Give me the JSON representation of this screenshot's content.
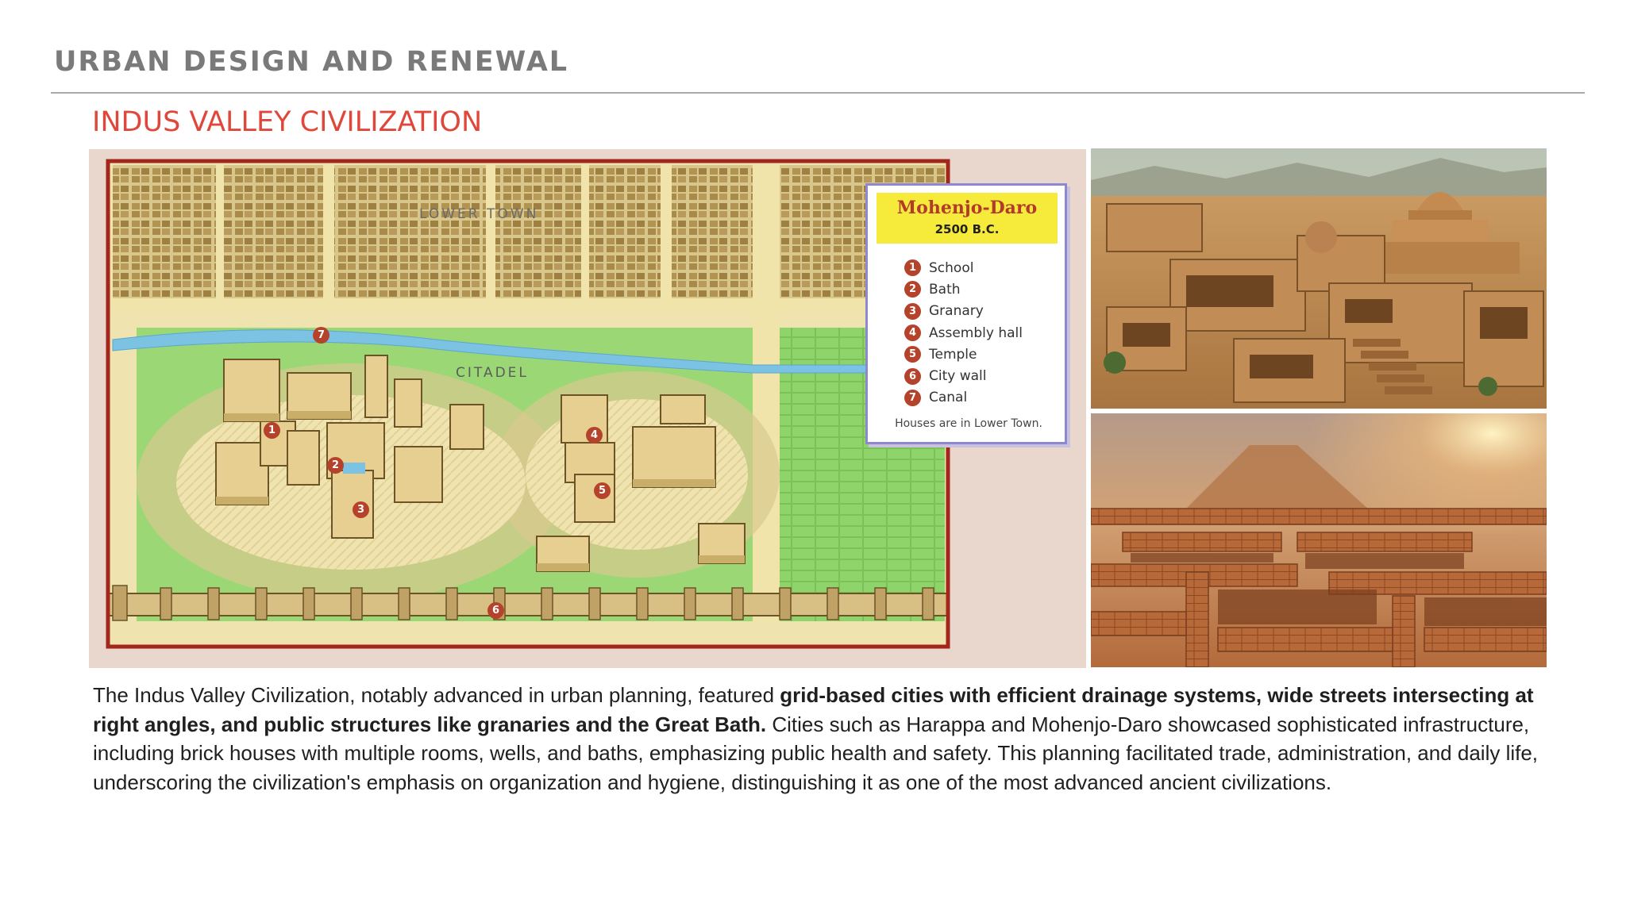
{
  "header": {
    "section_title": "URBAN DESIGN AND RENEWAL",
    "subtitle": "INDUS VALLEY CIVILIZATION"
  },
  "map": {
    "region_labels": {
      "lower_town": "LOWER TOWN",
      "citadel": "CITADEL"
    },
    "legend": {
      "title": "Mohenjo-Daro",
      "date": "2500 B.C.",
      "items": [
        {
          "num": "1",
          "label": "School"
        },
        {
          "num": "2",
          "label": "Bath"
        },
        {
          "num": "3",
          "label": "Granary"
        },
        {
          "num": "4",
          "label": "Assembly hall"
        },
        {
          "num": "5",
          "label": "Temple"
        },
        {
          "num": "6",
          "label": "City wall"
        },
        {
          "num": "7",
          "label": "Canal"
        }
      ],
      "note": "Houses are in Lower Town."
    },
    "markers": [
      "1",
      "2",
      "3",
      "4",
      "5",
      "6",
      "7"
    ]
  },
  "photos": [
    {
      "name": "ruins-with-stupa-photo"
    },
    {
      "name": "excavated-brick-ruins-photo"
    }
  ],
  "body": {
    "p1": "The Indus Valley Civilization, notably advanced in urban planning, featured ",
    "p2_bold": "grid-based cities with efficient drainage systems, wide streets intersecting at right angles, and public structures like granaries and the Great Bath.",
    "p3": " Cities such as Harappa and Mohenjo-Daro showcased sophisticated infrastructure, including brick houses with multiple rooms, wells, and baths, emphasizing public health and safety. This planning facilitated trade, administration, and daily life, underscoring the civilization's emphasis on organization and hygiene, distinguishing it as one of the most advanced ancient civilizations."
  },
  "colors": {
    "title_gray": "#7a7a7a",
    "subtitle_red": "#e0473b",
    "marker_red": "#b5422b",
    "legend_yellow": "#f6ea3b"
  }
}
